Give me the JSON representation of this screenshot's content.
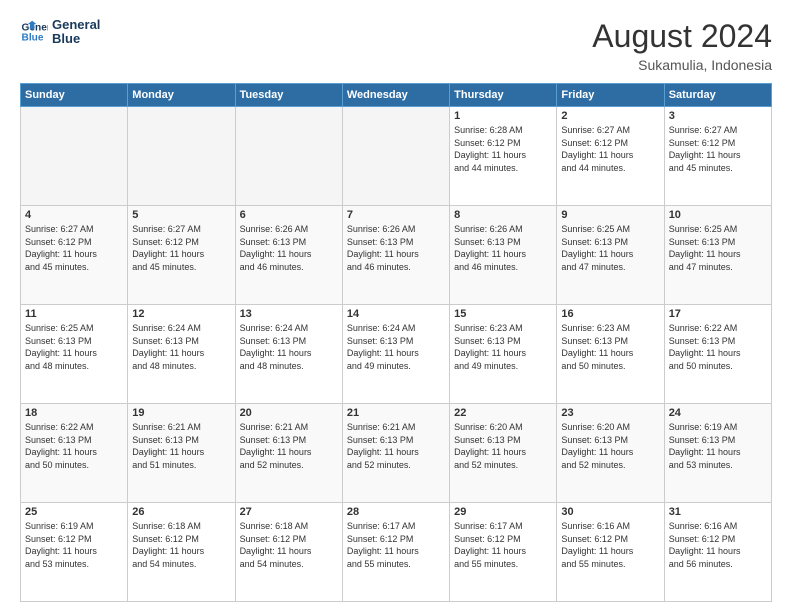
{
  "header": {
    "logo_line1": "General",
    "logo_line2": "Blue",
    "month_year": "August 2024",
    "location": "Sukamulia, Indonesia"
  },
  "days_of_week": [
    "Sunday",
    "Monday",
    "Tuesday",
    "Wednesday",
    "Thursday",
    "Friday",
    "Saturday"
  ],
  "weeks": [
    [
      {
        "day": "",
        "info": ""
      },
      {
        "day": "",
        "info": ""
      },
      {
        "day": "",
        "info": ""
      },
      {
        "day": "",
        "info": ""
      },
      {
        "day": "1",
        "info": "Sunrise: 6:28 AM\nSunset: 6:12 PM\nDaylight: 11 hours\nand 44 minutes."
      },
      {
        "day": "2",
        "info": "Sunrise: 6:27 AM\nSunset: 6:12 PM\nDaylight: 11 hours\nand 44 minutes."
      },
      {
        "day": "3",
        "info": "Sunrise: 6:27 AM\nSunset: 6:12 PM\nDaylight: 11 hours\nand 45 minutes."
      }
    ],
    [
      {
        "day": "4",
        "info": "Sunrise: 6:27 AM\nSunset: 6:12 PM\nDaylight: 11 hours\nand 45 minutes."
      },
      {
        "day": "5",
        "info": "Sunrise: 6:27 AM\nSunset: 6:12 PM\nDaylight: 11 hours\nand 45 minutes."
      },
      {
        "day": "6",
        "info": "Sunrise: 6:26 AM\nSunset: 6:13 PM\nDaylight: 11 hours\nand 46 minutes."
      },
      {
        "day": "7",
        "info": "Sunrise: 6:26 AM\nSunset: 6:13 PM\nDaylight: 11 hours\nand 46 minutes."
      },
      {
        "day": "8",
        "info": "Sunrise: 6:26 AM\nSunset: 6:13 PM\nDaylight: 11 hours\nand 46 minutes."
      },
      {
        "day": "9",
        "info": "Sunrise: 6:25 AM\nSunset: 6:13 PM\nDaylight: 11 hours\nand 47 minutes."
      },
      {
        "day": "10",
        "info": "Sunrise: 6:25 AM\nSunset: 6:13 PM\nDaylight: 11 hours\nand 47 minutes."
      }
    ],
    [
      {
        "day": "11",
        "info": "Sunrise: 6:25 AM\nSunset: 6:13 PM\nDaylight: 11 hours\nand 48 minutes."
      },
      {
        "day": "12",
        "info": "Sunrise: 6:24 AM\nSunset: 6:13 PM\nDaylight: 11 hours\nand 48 minutes."
      },
      {
        "day": "13",
        "info": "Sunrise: 6:24 AM\nSunset: 6:13 PM\nDaylight: 11 hours\nand 48 minutes."
      },
      {
        "day": "14",
        "info": "Sunrise: 6:24 AM\nSunset: 6:13 PM\nDaylight: 11 hours\nand 49 minutes."
      },
      {
        "day": "15",
        "info": "Sunrise: 6:23 AM\nSunset: 6:13 PM\nDaylight: 11 hours\nand 49 minutes."
      },
      {
        "day": "16",
        "info": "Sunrise: 6:23 AM\nSunset: 6:13 PM\nDaylight: 11 hours\nand 50 minutes."
      },
      {
        "day": "17",
        "info": "Sunrise: 6:22 AM\nSunset: 6:13 PM\nDaylight: 11 hours\nand 50 minutes."
      }
    ],
    [
      {
        "day": "18",
        "info": "Sunrise: 6:22 AM\nSunset: 6:13 PM\nDaylight: 11 hours\nand 50 minutes."
      },
      {
        "day": "19",
        "info": "Sunrise: 6:21 AM\nSunset: 6:13 PM\nDaylight: 11 hours\nand 51 minutes."
      },
      {
        "day": "20",
        "info": "Sunrise: 6:21 AM\nSunset: 6:13 PM\nDaylight: 11 hours\nand 52 minutes."
      },
      {
        "day": "21",
        "info": "Sunrise: 6:21 AM\nSunset: 6:13 PM\nDaylight: 11 hours\nand 52 minutes."
      },
      {
        "day": "22",
        "info": "Sunrise: 6:20 AM\nSunset: 6:13 PM\nDaylight: 11 hours\nand 52 minutes."
      },
      {
        "day": "23",
        "info": "Sunrise: 6:20 AM\nSunset: 6:13 PM\nDaylight: 11 hours\nand 52 minutes."
      },
      {
        "day": "24",
        "info": "Sunrise: 6:19 AM\nSunset: 6:13 PM\nDaylight: 11 hours\nand 53 minutes."
      }
    ],
    [
      {
        "day": "25",
        "info": "Sunrise: 6:19 AM\nSunset: 6:12 PM\nDaylight: 11 hours\nand 53 minutes."
      },
      {
        "day": "26",
        "info": "Sunrise: 6:18 AM\nSunset: 6:12 PM\nDaylight: 11 hours\nand 54 minutes."
      },
      {
        "day": "27",
        "info": "Sunrise: 6:18 AM\nSunset: 6:12 PM\nDaylight: 11 hours\nand 54 minutes."
      },
      {
        "day": "28",
        "info": "Sunrise: 6:17 AM\nSunset: 6:12 PM\nDaylight: 11 hours\nand 55 minutes."
      },
      {
        "day": "29",
        "info": "Sunrise: 6:17 AM\nSunset: 6:12 PM\nDaylight: 11 hours\nand 55 minutes."
      },
      {
        "day": "30",
        "info": "Sunrise: 6:16 AM\nSunset: 6:12 PM\nDaylight: 11 hours\nand 55 minutes."
      },
      {
        "day": "31",
        "info": "Sunrise: 6:16 AM\nSunset: 6:12 PM\nDaylight: 11 hours\nand 56 minutes."
      }
    ]
  ]
}
